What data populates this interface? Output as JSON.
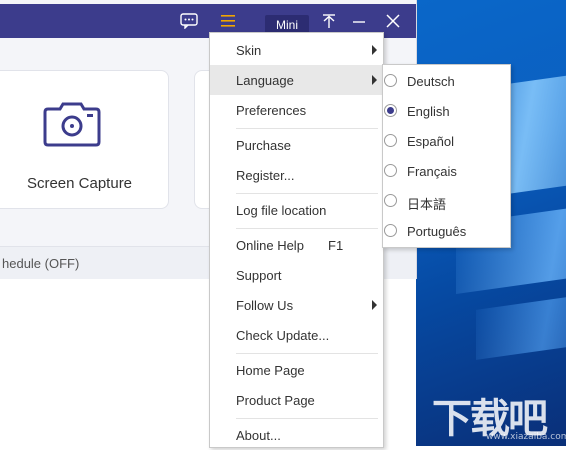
{
  "title_bar": {
    "mini_label": "Mini",
    "icons": [
      "chat-icon",
      "menu-icon",
      "pin-icon",
      "minimize-icon",
      "close-icon"
    ]
  },
  "cards": [
    {
      "label": "Screen Capture",
      "icon": "camera-icon"
    }
  ],
  "bottom_bar": {
    "schedule_text": "hedule (OFF)"
  },
  "main_menu": {
    "items": [
      {
        "label": "Skin",
        "submenu": true
      },
      {
        "label": "Language",
        "submenu": true,
        "highlighted": true
      },
      {
        "label": "Preferences"
      },
      {
        "label": "Purchase"
      },
      {
        "label": "Register..."
      },
      {
        "label": "Log file location"
      },
      {
        "label": "Online Help",
        "shortcut": "F1"
      },
      {
        "label": "Support"
      },
      {
        "label": "Follow Us",
        "submenu": true
      },
      {
        "label": "Check Update..."
      },
      {
        "label": "Home Page"
      },
      {
        "label": "Product Page"
      },
      {
        "label": "About..."
      }
    ]
  },
  "language_menu": {
    "selected": "English",
    "items": [
      "Deutsch",
      "English",
      "Español",
      "Français",
      "日本語",
      "Português"
    ]
  },
  "watermark": {
    "text": "下载吧",
    "sub": "www.xiazaiba.com"
  },
  "colors": {
    "titlebar": "#3c3c8c",
    "accent": "#3c3c8c",
    "menu_hover": "#e8e8e8"
  }
}
